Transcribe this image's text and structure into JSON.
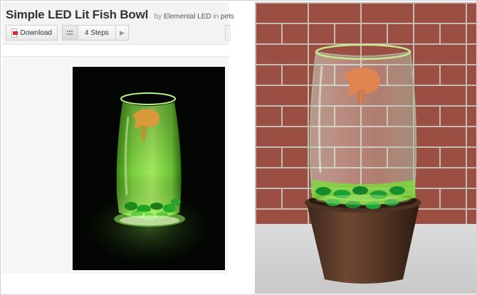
{
  "header": {
    "title": "Simple LED Lit Fish Bowl",
    "by_prefix": "by",
    "author": "Elemental LED",
    "in_word": "in",
    "category": "pets"
  },
  "toolbar": {
    "download_label": "Download",
    "steps_label": "4 Steps"
  },
  "icons": {
    "download": "pdf-icon",
    "view": "grid-icon",
    "next": "chevron-right-icon"
  },
  "colors": {
    "led_green": "#7ee04a",
    "brick": "#9b4f43"
  },
  "images": {
    "left": "led-fish-bowl-glowing-dark",
    "right": "fish-bowl-on-planter-brick-wall"
  }
}
